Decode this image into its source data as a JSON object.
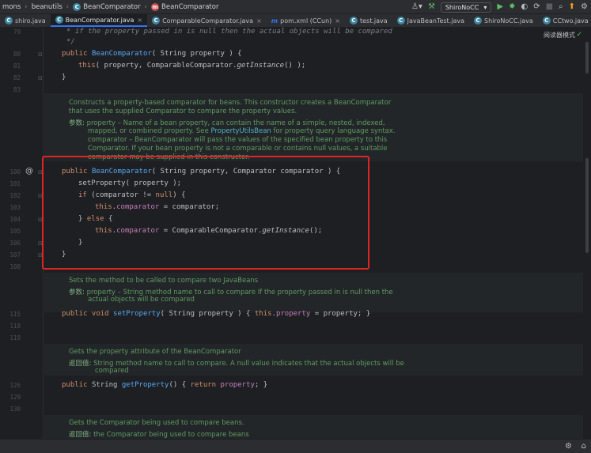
{
  "breadcrumb": {
    "items": [
      "mons",
      "beanutils",
      "BeanComparator",
      "BeanComparator"
    ]
  },
  "toolbar": {
    "branch": "ShiroNoCC",
    "icons": [
      "hammer-icon",
      "run-icon",
      "debug-icon",
      "coverage-icon",
      "profile-icon",
      "stop-icon",
      "search-icon",
      "update-icon",
      "settings-icon"
    ]
  },
  "tabs": [
    {
      "label": "shiro.java",
      "active": false
    },
    {
      "label": "BeanComparator.java",
      "active": true
    },
    {
      "label": "ComparableComparator.java",
      "active": false
    },
    {
      "label": "pom.xml (CCun)",
      "active": false
    },
    {
      "label": "test.java",
      "active": false
    },
    {
      "label": "JavaBeanTest.java",
      "active": false
    },
    {
      "label": "ShiroNoCC.java",
      "active": false
    },
    {
      "label": "CCtwo.java",
      "active": false
    }
  ],
  "editor": {
    "reader_mode": "阅读器模式",
    "line_numbers": {
      "l79": "79",
      "l80": "80",
      "l81": "81",
      "l82": "82",
      "l83": "83",
      "l100": "100",
      "l101": "101",
      "l102": "102",
      "l103": "103",
      "l104": "104",
      "l105": "105",
      "l106": "106",
      "l107": "107",
      "l108": "108",
      "l115": "115",
      "l118": "118",
      "l119": "119",
      "l126": "126",
      "l129": "129",
      "l130": "130"
    },
    "code": {
      "c_top": "* if the property passed in is null then the actual objects will be compared",
      "c_top_end": "*/",
      "l80_pub": "public ",
      "l80_fn": "BeanComparator",
      "l80_rest": "( String property ) {",
      "l81_this": "this",
      "l81_mid": "( property, ComparableComparator.",
      "l81_fn": "getInstance",
      "l81_end": "() );",
      "l82": "}",
      "l100_pub": "public ",
      "l100_fn": "BeanComparator",
      "l100_rest": "( String property, Comparator comparator ) {",
      "l101": "setProperty( property );",
      "l102_if": "if ",
      "l102_a": "(comparator != ",
      "l102_null": "null",
      "l102_b": ") {",
      "l103_this": "this",
      "l103_dot": ".",
      "l103_fld": "comparator",
      "l103_rest": " = comparator;",
      "l104_a": "} ",
      "l104_else": "else",
      "l104_b": " {",
      "l105_this": "this",
      "l105_dot": ".",
      "l105_fld": "comparator",
      "l105_mid": " = ComparableComparator.",
      "l105_fn": "getInstance",
      "l105_end": "();",
      "l106": "}",
      "l107": "}",
      "l115_pub": "public void ",
      "l115_fn": "setProperty",
      "l115_a": "( String property ) { ",
      "l115_this": "this",
      "l115_dot": ".",
      "l115_fld": "property",
      "l115_b": " = property; }",
      "l126_pub": "public ",
      "l126_type": "String ",
      "l126_fn": "getProperty",
      "l126_a": "() { ",
      "l126_ret": "return ",
      "l126_fld": "property",
      "l126_b": "; }"
    },
    "docs": {
      "d1_l1": "Constructs a property-based comparator for beans. This constructor creates a BeanComparator",
      "d1_l2": "that uses the supplied Comparator to compare the property values.",
      "d1_lbl": "参数:",
      "d1_l3": " property – Name of a bean property, can contain the name of a simple, nested, indexed,",
      "d1_l4a": "mapped, or combined property. See ",
      "d1_l4link": "PropertyUtilsBean",
      "d1_l4b": " for property query language syntax.",
      "d1_l5": "comparator – BeanComparator will pass the values of the specified bean property to this",
      "d1_l6": "Comparator. If your bean property is not a comparable or contains null values, a suitable",
      "d1_l7": "comparator may be supplied in this constructor.",
      "d2_l1": "Sets the method to be called to compare two JavaBeans",
      "d2_lbl": "参数:",
      "d2_l2": " property – String method name to call to compare If the property passed in is null then the",
      "d2_l3": "actual objects will be compared",
      "d3_l1": "Gets the property attribute of the BeanComparator",
      "d3_lbl": "返回值:",
      "d3_l2": " String method name to call to compare. A null value indicates that the actual objects will be",
      "d3_l3": "compared",
      "d4_l1": "Gets the Comparator being used to compare beans.",
      "d4_lbl": "返回值:",
      "d4_l2": " the Comparator being used to compare beans"
    }
  },
  "colors": {
    "highlight_border": "#e02424",
    "keyword": "#cf8e6d",
    "function": "#56a8f5",
    "field": "#c77dbb",
    "doc_text": "#5f9a61",
    "accent": "#3574f0"
  }
}
